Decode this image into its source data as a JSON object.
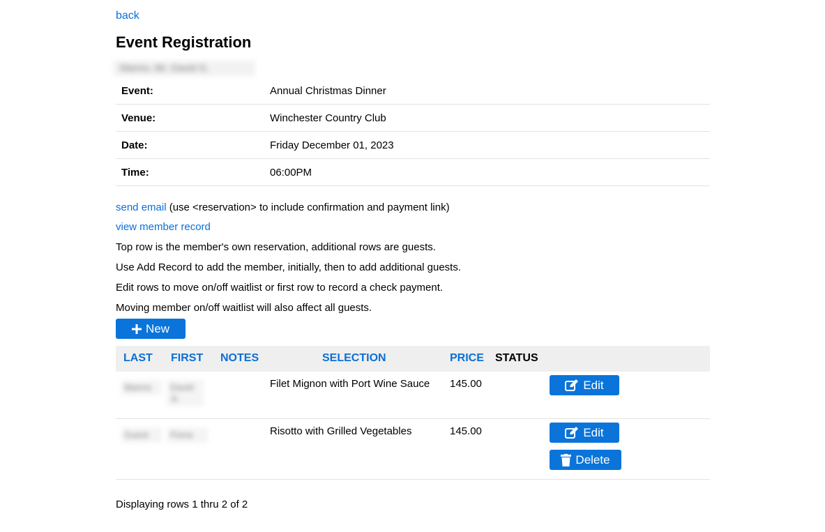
{
  "nav": {
    "back_label": "back"
  },
  "page": {
    "title": "Event Registration",
    "member_name": "Manns, Mr. David G."
  },
  "details": [
    {
      "label": "Event:",
      "value": "Annual Christmas Dinner"
    },
    {
      "label": "Venue:",
      "value": "Winchester Country Club"
    },
    {
      "label": "Date:",
      "value": "Friday December 01, 2023"
    },
    {
      "label": "Time:",
      "value": "06:00PM"
    }
  ],
  "links": {
    "send_email": "send email",
    "send_email_note": " (use <reservation> to include confirmation and payment link)",
    "view_member": "view member record"
  },
  "instructions": [
    "Top row is the member's own reservation, additional rows are guests.",
    "Use Add Record to add the member, initially, then to add additional guests.",
    "Edit rows to move on/off waitlist or first row to record a check payment.",
    "Moving member on/off waitlist will also affect all guests."
  ],
  "buttons": {
    "new_label": "New",
    "edit_label": "Edit",
    "delete_label": "Delete"
  },
  "table": {
    "columns": {
      "last": "LAST",
      "first": "FIRST",
      "notes": "NOTES",
      "selection": "SELECTION",
      "price": "PRICE",
      "status": "STATUS"
    },
    "rows": [
      {
        "last": "Manns",
        "first": "David Jr.",
        "notes": "",
        "selection": "Filet Mignon with Port Wine Sauce",
        "price": "145.00",
        "status": ""
      },
      {
        "last": "Guest",
        "first": "Fiona",
        "notes": "",
        "selection": "Risotto with Grilled Vegetables",
        "price": "145.00",
        "status": ""
      }
    ]
  },
  "footer": {
    "text": "Displaying rows 1 thru 2 of 2"
  },
  "colors": {
    "link": "#0a6fd6",
    "button": "#0a74da",
    "header_bg": "#efefef"
  }
}
